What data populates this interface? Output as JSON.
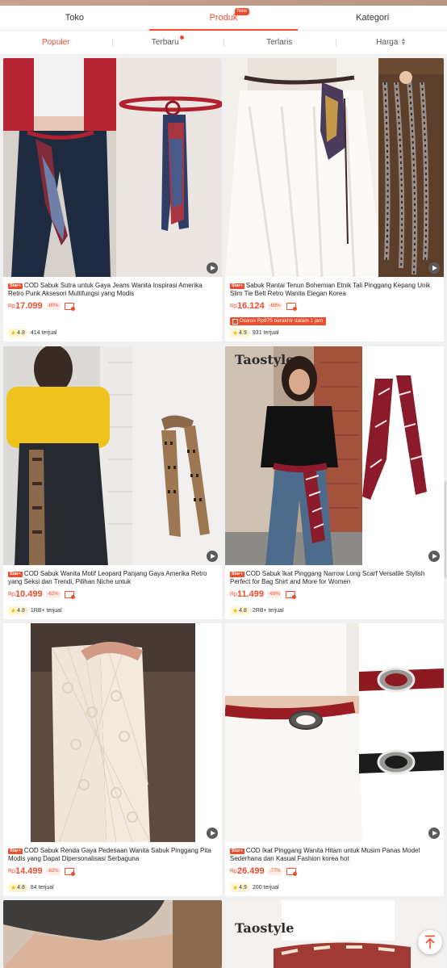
{
  "tabs": [
    {
      "label": "Toko"
    },
    {
      "label": "Produk",
      "badge": "New"
    },
    {
      "label": "Kategori"
    }
  ],
  "sort": {
    "populer": "Populer",
    "terbaru": "Terbaru",
    "terlaris": "Terlaris",
    "harga": "Harga"
  },
  "products": [
    {
      "badge": "Star+",
      "title": "COD Sabuk Sutra untuk Gaya Jeans Wanita Inspirasi Amerika Retro Punk Aksesori Multifungsi yang Modis",
      "currency": "Rp",
      "price": "17.099",
      "discount": "-80%",
      "rating": "4.8",
      "sold": "414 terjual"
    },
    {
      "badge": "Star+",
      "title": "Sabuk Rantai Tenun Bohemian Etnik Tali Pinggang Kepang Unik Slim Tie Belt Retro Wanita Elegan Korea",
      "currency": "Rp",
      "price": "16.124",
      "discount": "-68%",
      "promo": "Diskon Rp975 berakhir dalam 1 jam",
      "rating": "4.9",
      "sold": "931 terjual"
    },
    {
      "badge": "Star+",
      "title": "COD Sabuk Wanita Motif Leopard Panjang Gaya Amerika Retro yang Seksi dan Trendi, Pilihan Niche untuk",
      "currency": "Rp",
      "price": "10.499",
      "discount": "-62%",
      "rating": "4.8",
      "sold": "1RB+ terjual"
    },
    {
      "badge": "Star+",
      "title": "COD Sabuk Ikat Pinggang Narrow Long Scarf Versatile Stylish Perfect for Bag Shirt and More for Women",
      "currency": "Rp",
      "price": "11.499",
      "discount": "-68%",
      "rating": "4.8",
      "sold": "2RB+ terjual",
      "watermark": "Taostyle"
    },
    {
      "badge": "Star+",
      "title": "COD Sabuk Renda Gaya Pedesaan Wanita Sabuk Pinggang Pita Modis yang Dapat Dipersonalisasi Serbaguna",
      "currency": "Rp",
      "price": "14.499",
      "discount": "-82%",
      "rating": "4.8",
      "sold": "84 terjual"
    },
    {
      "badge": "Star+",
      "title": "COD Ikat Pinggang Wanita Hitam untuk Musim Panas Model Sederhana dan Kasual Fashion korea hot",
      "currency": "Rp",
      "price": "26.499",
      "discount": "-77%",
      "rating": "4.9",
      "sold": "200 terjual"
    },
    {},
    {
      "watermark": "Taostyle"
    }
  ],
  "colors": {
    "accent": "#ee4d2d",
    "star": "#f5b800"
  },
  "icons": {
    "play": "play-icon",
    "cod": "cod-icon",
    "star": "star-icon",
    "scroll_top": "arrow-up-icon"
  }
}
